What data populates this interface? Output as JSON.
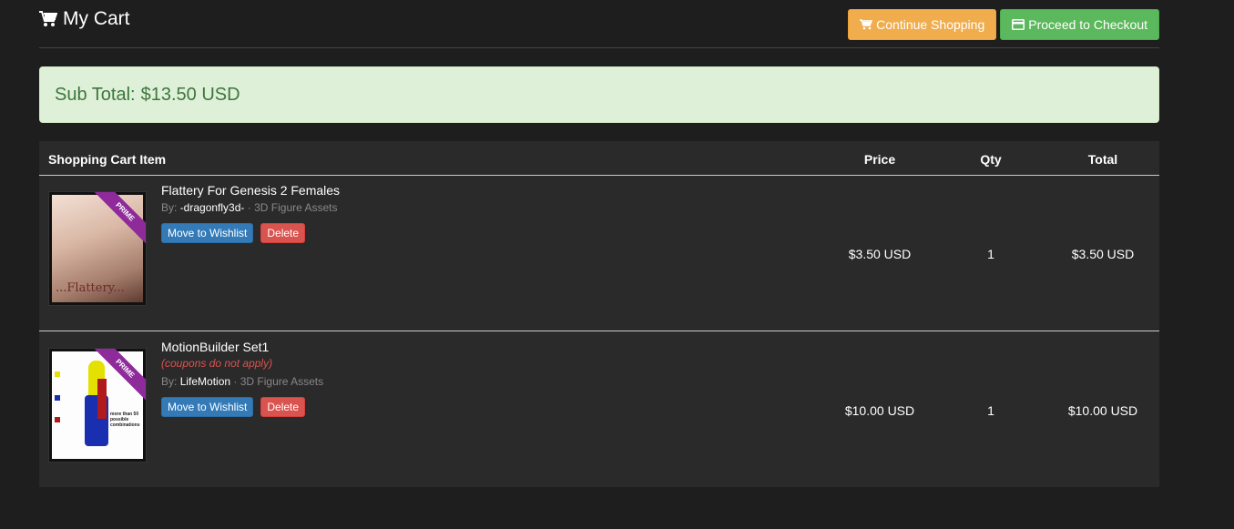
{
  "header": {
    "title": "My Cart",
    "title_icon": "shopping-cart-icon"
  },
  "buttons": {
    "continue_label": "Continue Shopping",
    "checkout_label": "Proceed to Checkout"
  },
  "subtotal": {
    "label": "Sub Total:",
    "amount": "$13.50 USD"
  },
  "table": {
    "columns": [
      "Shopping Cart Item",
      "Price",
      "Qty",
      "Total"
    ],
    "items": [
      {
        "name": "Flattery For Genesis 2 Females",
        "note": "",
        "by_label": "By:",
        "artist": "-dragonfly3d-",
        "category": "3D Figure Assets",
        "badge": "PRIME",
        "thumb_text": "...Flattery...",
        "wishlist_label": "Move to Wishlist",
        "delete_label": "Delete",
        "price": "$3.50 USD",
        "qty": "1",
        "total": "$3.50 USD"
      },
      {
        "name": "MotionBuilder Set1",
        "note": "(coupons do not apply)",
        "by_label": "By:",
        "artist": "LifeMotion",
        "category": "3D Figure Assets",
        "badge": "PRIME",
        "thumb_text": "more than 50 possible combinations",
        "wishlist_label": "Move to Wishlist",
        "delete_label": "Delete",
        "price": "$10.00 USD",
        "qty": "1",
        "total": "$10.00 USD"
      }
    ]
  },
  "colors": {
    "background": "#1e1e1e",
    "warning": "#f0ad4e",
    "success": "#5cb85c",
    "alert_bg": "#dff0d8",
    "alert_text": "#3c763d",
    "primary": "#337ab7",
    "danger": "#d9534f",
    "ribbon": "#8e2a9a"
  }
}
